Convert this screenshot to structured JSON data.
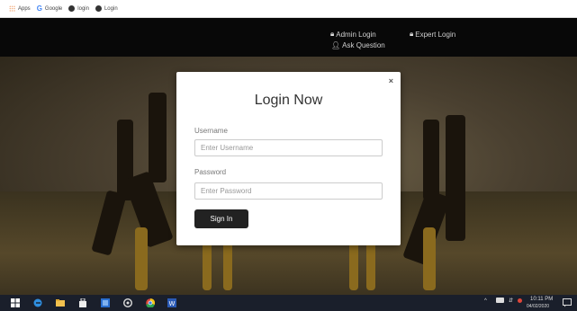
{
  "bookmarks": [
    {
      "label": "Apps",
      "icon": "apps-icon"
    },
    {
      "label": "Google",
      "icon": "google-icon"
    },
    {
      "label": "login",
      "icon": "globe-icon"
    },
    {
      "label": "Login",
      "icon": "globe-icon"
    }
  ],
  "nav": {
    "admin_login": "Admin Login",
    "ask_question": "Ask Question",
    "expert_login": "Expert Login"
  },
  "modal": {
    "close": "×",
    "title": "Login Now",
    "username_label": "Username",
    "username_placeholder": "Enter Username",
    "username_value": "",
    "password_label": "Password",
    "password_placeholder": "Enter Password",
    "password_value": "",
    "submit_label": "Sign In"
  },
  "taskbar": {
    "time": "10:11 PM",
    "date": "04/02/2020",
    "apps": [
      "start-icon",
      "edge-icon",
      "file-explorer-icon",
      "store-icon",
      "app-icon",
      "settings-icon",
      "chrome-icon",
      "word-icon"
    ]
  },
  "colors": {
    "header": "#080808",
    "button": "#222222",
    "taskbar": "#1a1f2b"
  }
}
